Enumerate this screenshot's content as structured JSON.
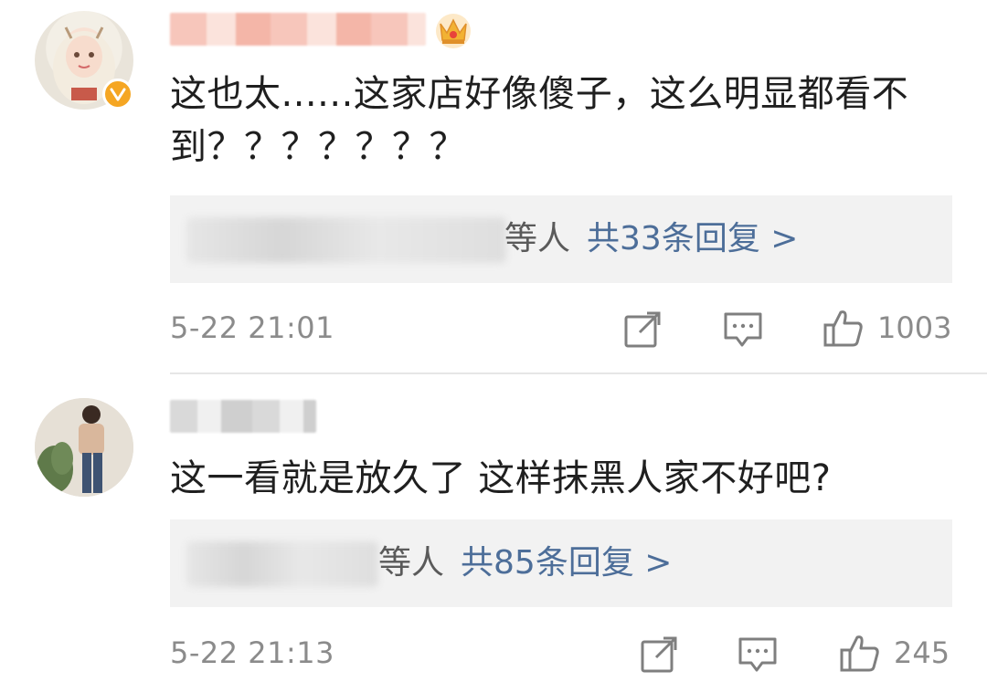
{
  "comments": [
    {
      "text": "这也太......这家店好像傻子，这么明显都看不到？？？？？？？",
      "reply_suffix": "等人",
      "reply_count": "共33条回复 >",
      "timestamp": "5-22 21:01",
      "likes": "1003",
      "verified": true,
      "vip_crown_icon": "crown-icon"
    },
    {
      "text": "这一看就是放久了 这样抹黑人家不好吧?",
      "reply_suffix": "等人",
      "reply_count": "共85条回复 >",
      "timestamp": "5-22 21:13",
      "likes": "245"
    }
  ],
  "icons": {
    "share": "share-icon",
    "comment": "comment-icon",
    "like": "thumbs-up-icon",
    "verified": "verified-badge-icon"
  },
  "colors": {
    "link": "#4d6e99",
    "meta": "#8b8b8b",
    "reply_bg": "#f2f2f2",
    "verified": "#f5a623"
  }
}
